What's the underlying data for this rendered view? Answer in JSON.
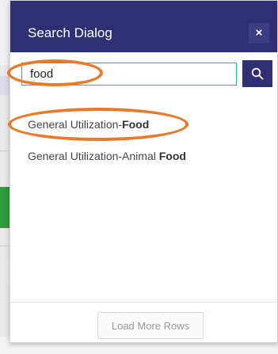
{
  "dialog": {
    "title": "Search Dialog",
    "close_label": "×"
  },
  "search": {
    "value": "food",
    "button_icon": "search-icon"
  },
  "results": [
    {
      "prefix": "General Utilization-",
      "match": "Food"
    },
    {
      "prefix": "General Utilization-Animal ",
      "match": "Food"
    }
  ],
  "footer": {
    "load_more_label": "Load More Rows"
  },
  "colors": {
    "titlebar": "#2f2f73",
    "input_border": "#3aa6a0",
    "highlight_ring": "#e97a2a"
  }
}
